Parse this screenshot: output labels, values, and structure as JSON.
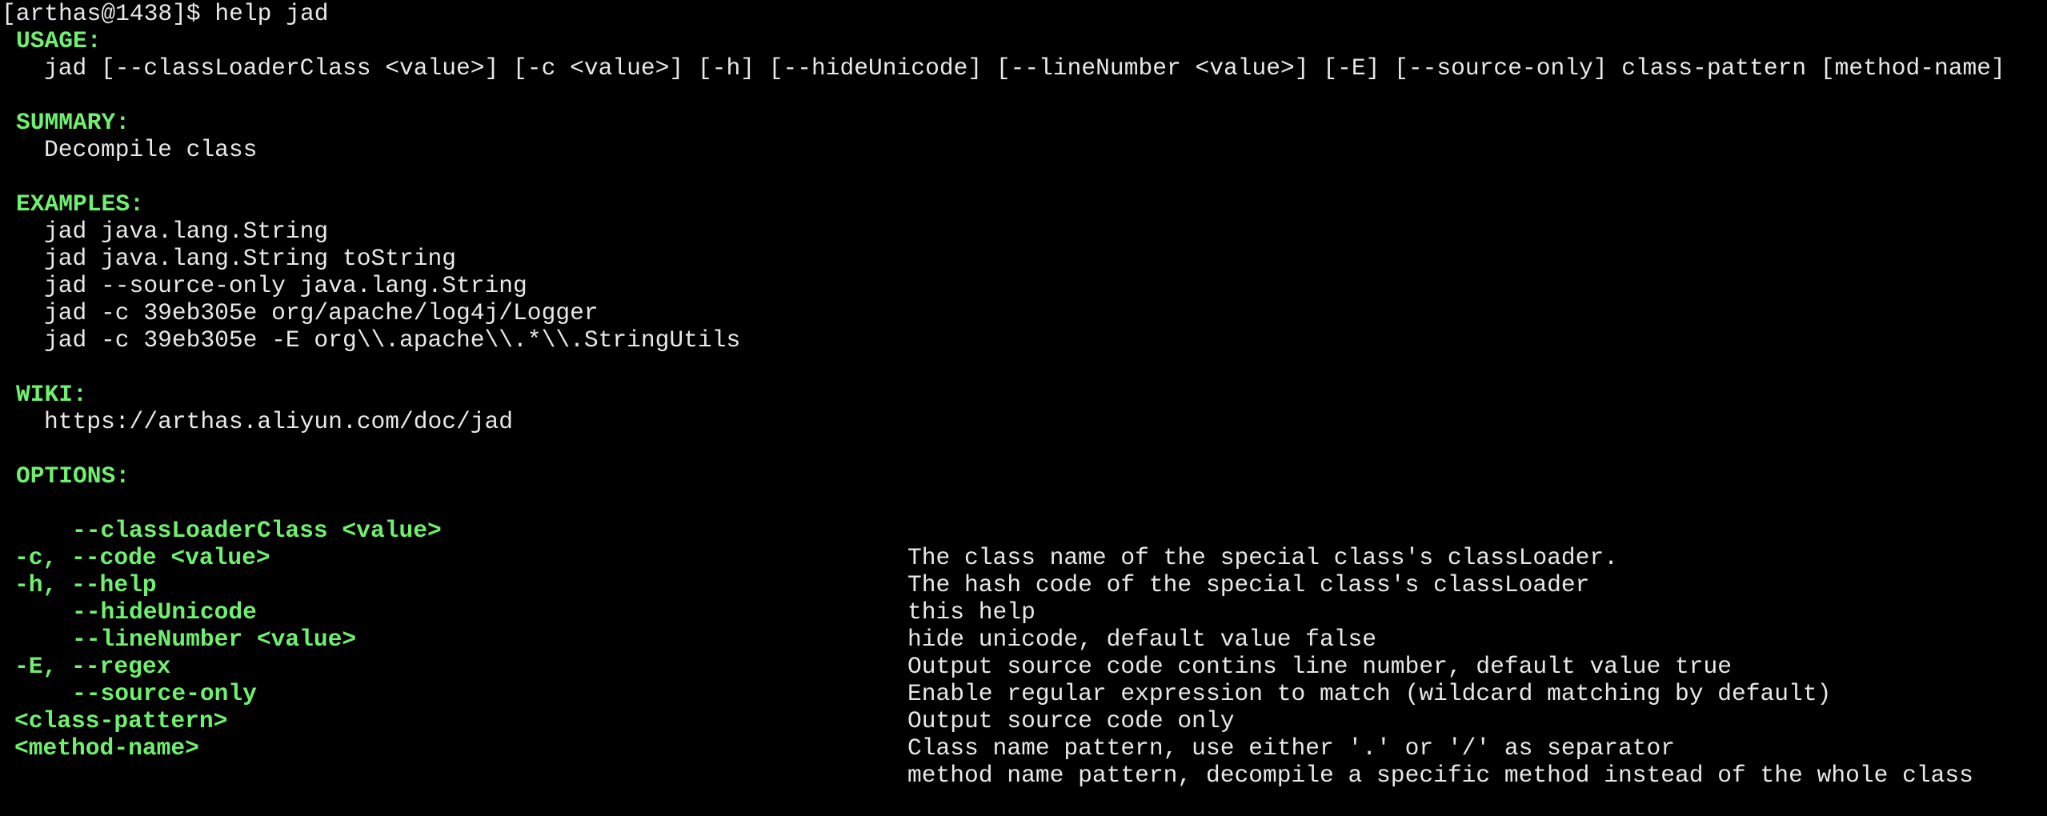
{
  "terminal": {
    "prompt_line": "[arthas@1438]$ help jad",
    "usage": {
      "header": "USAGE:",
      "text": "jad [--classLoaderClass <value>] [-c <value>] [-h] [--hideUnicode] [--lineNumber <value>] [-E] [--source-only] class-pattern [method-name]"
    },
    "summary": {
      "header": "SUMMARY:",
      "text": "Decompile class"
    },
    "examples": {
      "header": "EXAMPLES:",
      "items": [
        "jad java.lang.String",
        "jad java.lang.String toString",
        "jad --source-only java.lang.String",
        "jad -c 39eb305e org/apache/log4j/Logger",
        "jad -c 39eb305e -E org\\\\.apache\\\\.*\\\\.StringUtils"
      ]
    },
    "wiki": {
      "header": "WIKI:",
      "text": "https://arthas.aliyun.com/doc/jad"
    },
    "options": {
      "header": "OPTIONS:",
      "items": [
        {
          "name": "--classLoaderClass <value>",
          "desc": "The class name of the special class's classLoader."
        },
        {
          "name": "-c, --code <value>",
          "desc": "The hash code of the special class's classLoader"
        },
        {
          "name": "-h, --help",
          "desc": "this help"
        },
        {
          "name": "--hideUnicode",
          "desc": "hide unicode, default value false"
        },
        {
          "name": "--lineNumber <value>",
          "desc": "Output source code contins line number, default value true"
        },
        {
          "name": "-E, --regex",
          "desc": "Enable regular expression to match (wildcard matching by default)"
        },
        {
          "name": "--source-only",
          "desc": "Output source code only"
        },
        {
          "name": "<class-pattern>",
          "desc": "Class name pattern, use either '.' or '/' as separator"
        },
        {
          "name": "<method-name>",
          "desc": "method name pattern, decompile a specific method instead of the whole class"
        }
      ]
    },
    "colors": {
      "background": "#000000",
      "foreground": "#e8e8e8",
      "header_green": "#6ff06f"
    }
  }
}
